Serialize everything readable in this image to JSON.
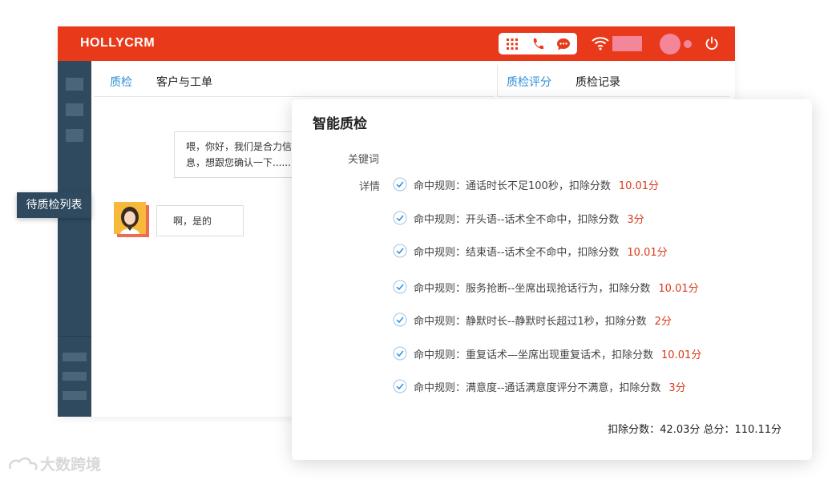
{
  "app": {
    "logo": "HOLLYCRM",
    "colors": {
      "topbar": "#e8391a",
      "sidebar": "#2f4a5f",
      "accent": "#2f8fd8",
      "score": "#d93a1b"
    }
  },
  "toolbar": {
    "icons": [
      "grid-icon",
      "phone-icon",
      "chat-icon",
      "wifi-icon",
      "power-icon"
    ]
  },
  "left_tabs": [
    {
      "label": "质检",
      "active": true
    },
    {
      "label": "客户与工单",
      "active": false
    }
  ],
  "right_tabs": [
    {
      "label": "质检评分",
      "active": true
    },
    {
      "label": "质检记录",
      "active": false
    }
  ],
  "chat": {
    "bubble1": "喂，你好，我们是合力信息，想跟您确认一下......",
    "bubble2": "啊，是的"
  },
  "tooltip": "待质检列表",
  "modal": {
    "title": "智能质检",
    "keyword_label": "关键词",
    "detail_label": "详情",
    "rules": [
      {
        "text": "命中规则：通话时长不足100秒，扣除分数",
        "score": "10.01分"
      },
      {
        "text": "命中规则：开头语--话术全不命中，扣除分数",
        "score": "3分"
      },
      {
        "text": "命中规则：结束语--话术全不命中，扣除分数",
        "score": "10.01分"
      },
      {
        "text": "命中规则：服务抢断--坐席出现抢话行为，扣除分数",
        "score": "10.01分"
      },
      {
        "text": "命中规则：静默时长--静默时长超过1秒，扣除分数",
        "score": "2分"
      },
      {
        "text": "命中规则：重复话术—坐席出现重复话术，扣除分数",
        "score": "10.01分"
      },
      {
        "text": "命中规则：满意度--通话满意度评分不满意，扣除分数",
        "score": "3分"
      }
    ],
    "totals": "扣除分数：42.03分 总分：110.11分"
  },
  "watermark": "大数跨境"
}
